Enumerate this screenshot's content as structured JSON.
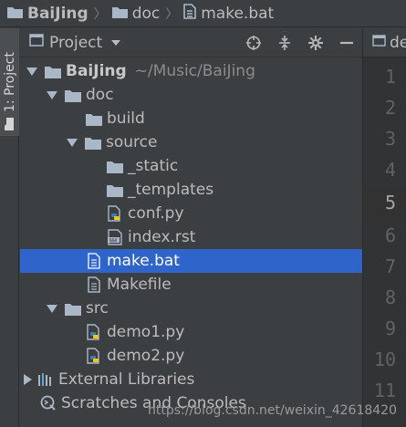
{
  "breadcrumb": {
    "items": [
      {
        "label": "BaiJing",
        "icon": "folder-icon"
      },
      {
        "label": "doc",
        "icon": "folder-icon"
      },
      {
        "label": "make.bat",
        "icon": "file-icon"
      }
    ],
    "separator": "〉"
  },
  "tool_stripe": {
    "label": "1: Project"
  },
  "project_panel": {
    "title": "Project",
    "tools": [
      "locate-icon",
      "collapse-icon",
      "settings-icon",
      "hide-icon"
    ]
  },
  "tree": [
    {
      "label": "BaiJing",
      "hint": "~/Music/BaiJing",
      "icon": "folder",
      "expanded": true,
      "depth": 0
    },
    {
      "label": "doc",
      "icon": "folder",
      "expanded": true,
      "depth": 1
    },
    {
      "label": "build",
      "icon": "folder",
      "depth": 2
    },
    {
      "label": "source",
      "icon": "folder",
      "expanded": true,
      "depth": 2
    },
    {
      "label": "_static",
      "icon": "folder",
      "depth": 3
    },
    {
      "label": "_templates",
      "icon": "folder",
      "depth": 3
    },
    {
      "label": "conf.py",
      "icon": "python",
      "depth": 3
    },
    {
      "label": "index.rst",
      "icon": "rst",
      "depth": 3
    },
    {
      "label": "make.bat",
      "icon": "text",
      "depth": 2,
      "selected": true
    },
    {
      "label": "Makefile",
      "icon": "text",
      "depth": 2
    },
    {
      "label": "src",
      "icon": "folder",
      "expanded": true,
      "depth": 1
    },
    {
      "label": "demo1.py",
      "icon": "python",
      "depth": 2
    },
    {
      "label": "demo2.py",
      "icon": "python",
      "depth": 2
    },
    {
      "label": "External Libraries",
      "icon": "library",
      "expanded": false,
      "depth": 0
    },
    {
      "label": "Scratches and Consoles",
      "icon": "scratch",
      "depth": 0
    }
  ],
  "editor": {
    "tab_label": "de",
    "line_numbers": [
      "1",
      "2",
      "3",
      "4",
      "5",
      "6",
      "7",
      "8",
      "9",
      "10",
      "11"
    ],
    "current_line": "5"
  },
  "watermark": "https://blog.csdn.net/weixin_42618420",
  "colors": {
    "background": "#3c3f41",
    "selection": "#2f65ca",
    "gutter": "#313335",
    "python_blue": "#3d7ab8",
    "python_yellow": "#f5c518"
  }
}
